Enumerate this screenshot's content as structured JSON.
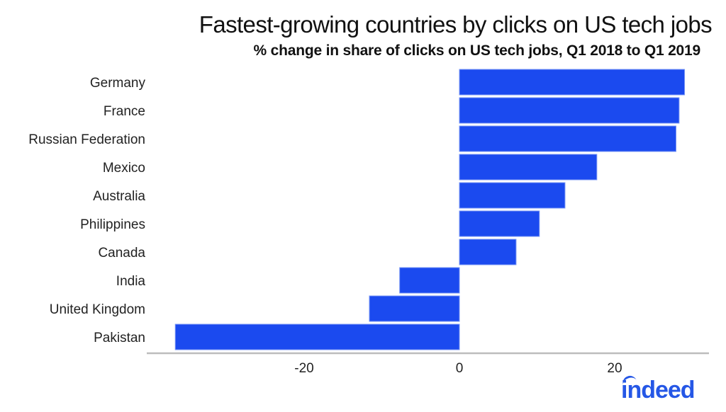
{
  "header": {
    "title": "Fastest-growing countries by clicks on US tech jobs",
    "subtitle": "% change in share of clicks on US tech jobs, Q1 2018 to Q1 2019"
  },
  "branding": {
    "logo_text": "indeed",
    "logo_color": "#2557e6"
  },
  "chart_data": {
    "type": "bar",
    "orientation": "horizontal",
    "title": "Fastest-growing countries by clicks on US tech jobs",
    "subtitle": "% change in share of clicks on US tech jobs, Q1 2018 to Q1 2019",
    "xlabel": "",
    "ylabel": "",
    "categories": [
      "Germany",
      "France",
      "Russian Federation",
      "Mexico",
      "Australia",
      "Philippines",
      "Canada",
      "India",
      "United Kingdom",
      "Pakistan"
    ],
    "values": [
      29.0,
      28.3,
      27.9,
      17.7,
      13.6,
      10.3,
      7.3,
      -7.7,
      -11.6,
      -36.6
    ],
    "xlim": [
      -40,
      32
    ],
    "xticks": [
      -20,
      0,
      20
    ],
    "xtick_labels": [
      "-20",
      "0",
      "20"
    ],
    "grid": false,
    "legend": "none",
    "bar_color": "#1b4aef"
  }
}
